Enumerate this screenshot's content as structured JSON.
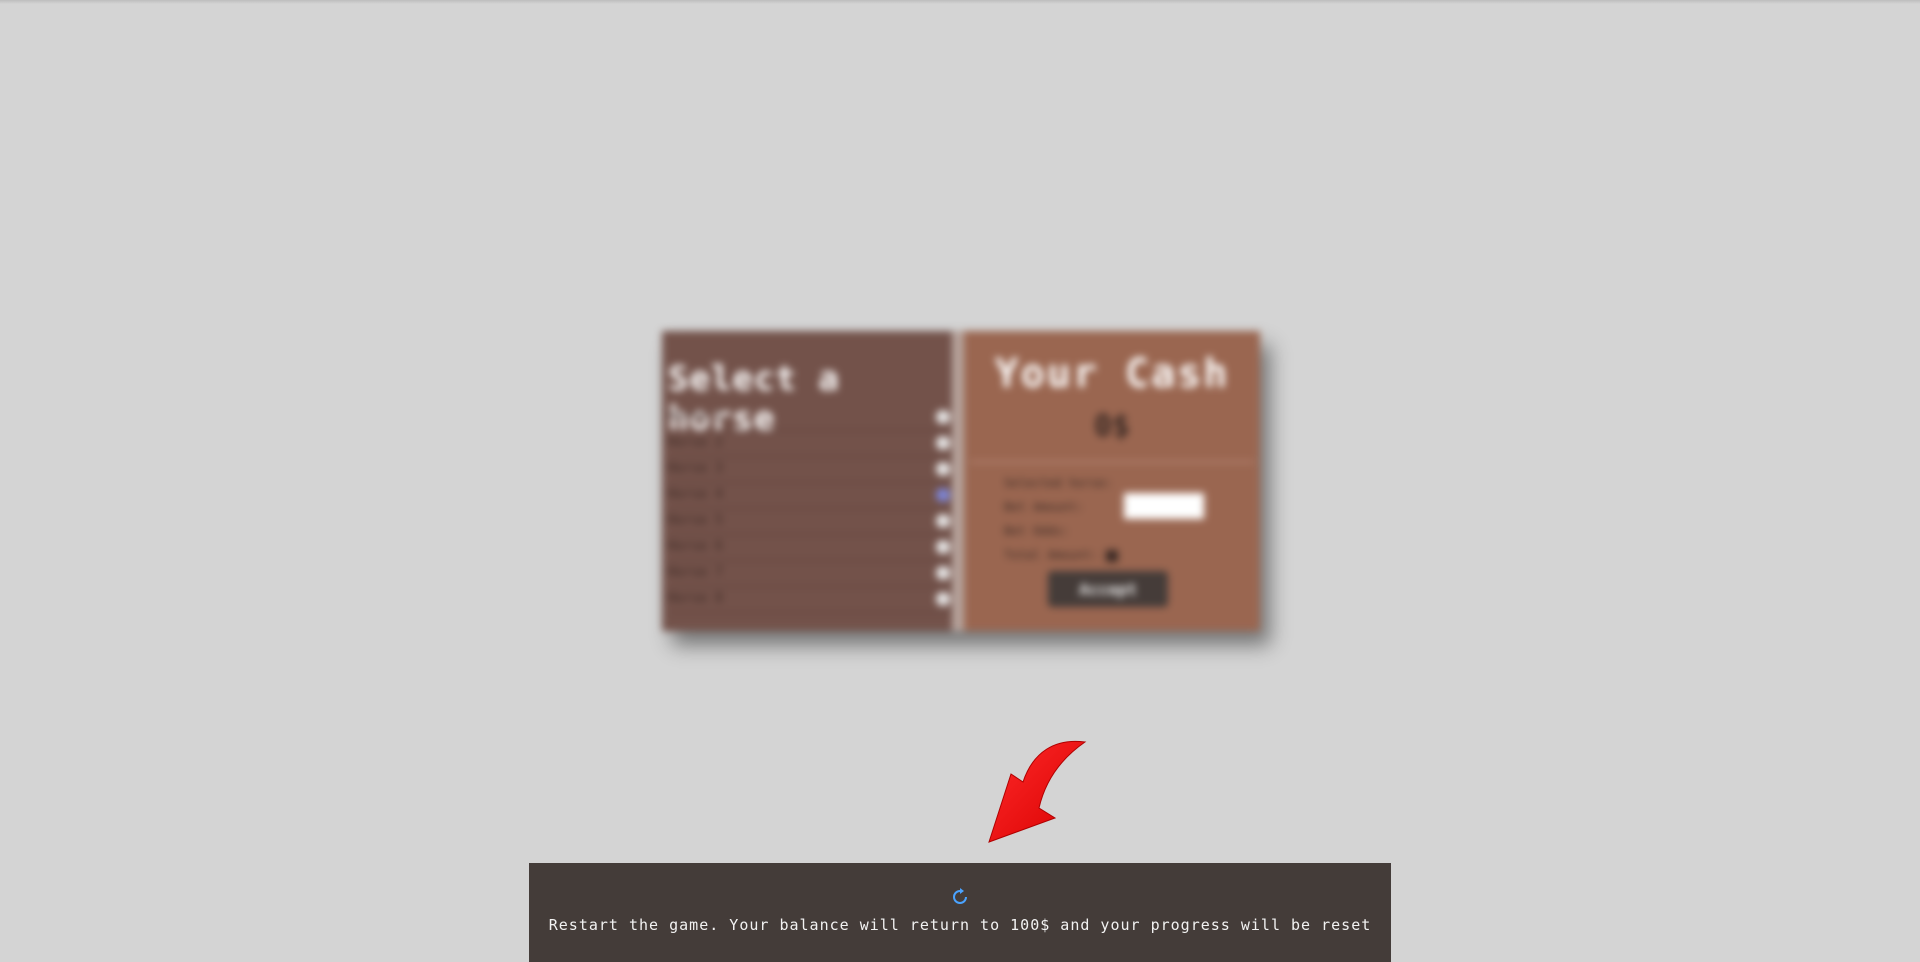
{
  "game": {
    "left_panel": {
      "title": "Select a horse",
      "horses": [
        {
          "name": "Horse 1",
          "selected": false
        },
        {
          "name": "Horse 2",
          "selected": false
        },
        {
          "name": "Horse 3",
          "selected": false
        },
        {
          "name": "Horse 4",
          "selected": true
        },
        {
          "name": "Horse 5",
          "selected": false
        },
        {
          "name": "Horse 6",
          "selected": false
        },
        {
          "name": "Horse 7",
          "selected": false
        },
        {
          "name": "Horse 8",
          "selected": false
        }
      ]
    },
    "right_panel": {
      "title": "Your Cash",
      "cash": "0$",
      "rows": [
        {
          "label": "Selected horse:"
        },
        {
          "label": "Bet Amount:"
        },
        {
          "label": "Bet Odds:"
        },
        {
          "label": "Total Amount:"
        }
      ],
      "accept_label": "Accept"
    }
  },
  "footer": {
    "restart_text": "Restart the game. Your balance will return to 100$ and your progress will be reset",
    "restart_icon": "restart-icon"
  },
  "colors": {
    "background": "#d4d4d4",
    "left_panel": "#73524a",
    "right_panel": "#9a6650",
    "footer": "#443c39",
    "arrow": "#ff0000"
  }
}
